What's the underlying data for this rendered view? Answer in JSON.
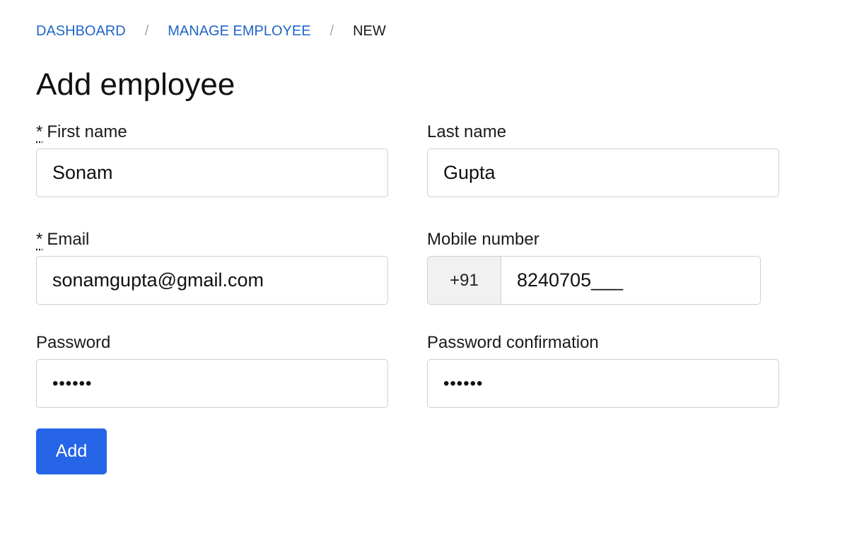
{
  "breadcrumb": {
    "items": [
      {
        "label": "DASHBOARD"
      },
      {
        "label": "MANAGE EMPLOYEE"
      }
    ],
    "separator": "/",
    "current": "NEW"
  },
  "page": {
    "title": "Add employee"
  },
  "form": {
    "first_name": {
      "required_mark": "*",
      "label": "First name",
      "value": "Sonam"
    },
    "last_name": {
      "label": "Last name",
      "value": "Gupta"
    },
    "email": {
      "required_mark": "*",
      "label": "Email",
      "value": "sonamgupta@gmail.com"
    },
    "mobile": {
      "label": "Mobile number",
      "prefix": "+91",
      "value": "8240705___"
    },
    "password": {
      "label": "Password",
      "value": "••••••"
    },
    "password_confirmation": {
      "label": "Password confirmation",
      "value": "••••••"
    },
    "submit_label": "Add"
  },
  "colors": {
    "link": "#1f66c6",
    "primary": "#2765e8",
    "border": "#cfcfcf"
  }
}
